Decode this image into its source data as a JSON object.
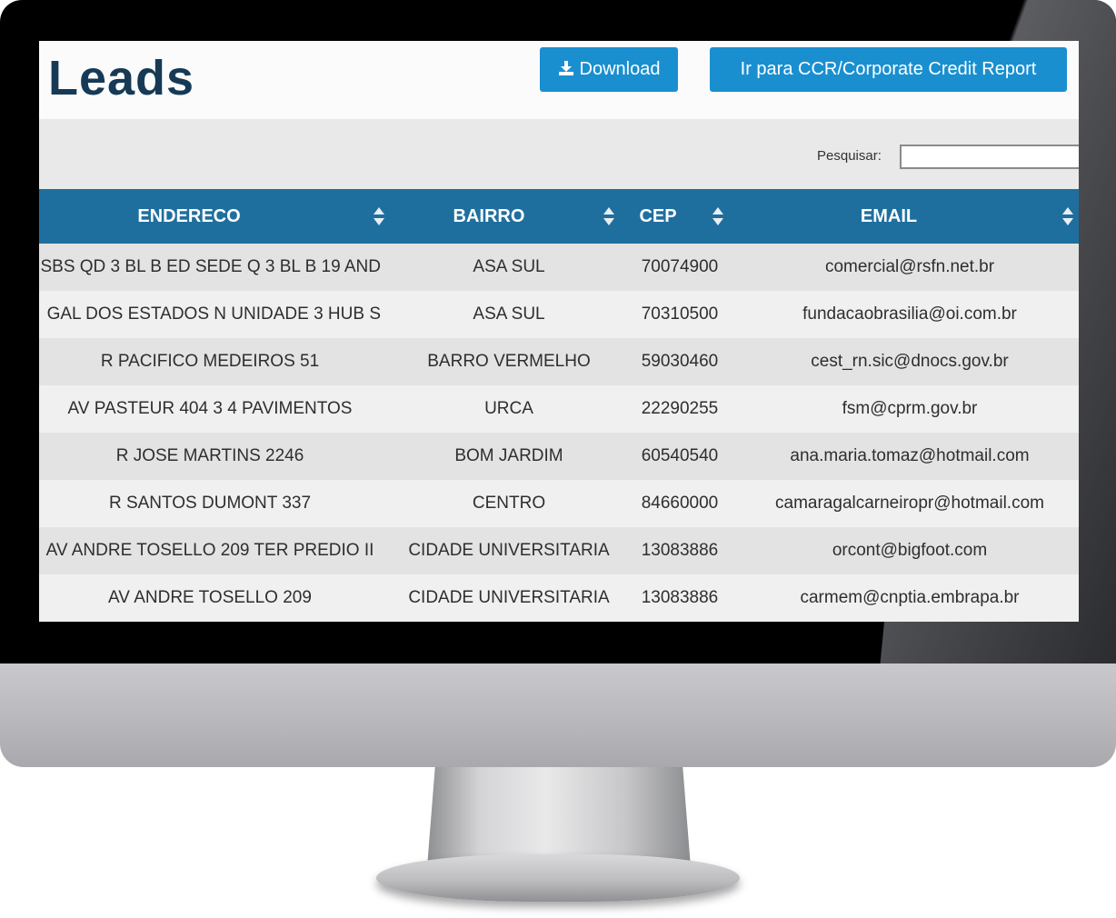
{
  "page": {
    "title": "Leads",
    "download_label": "Download",
    "ccr_label": "Ir para CCR/Corporate Credit Report"
  },
  "search": {
    "label": "Pesquisar:",
    "value": ""
  },
  "table": {
    "columns": [
      "ENDERECO",
      "BAIRRO",
      "CEP",
      "EMAIL"
    ],
    "rows": [
      {
        "endereco": "SBS QD 3 BL B ED SEDE Q 3 BL B 19 AND",
        "bairro": "ASA SUL",
        "cep": "70074900",
        "email": "comercial@rsfn.net.br"
      },
      {
        "endereco": "GAL DOS ESTADOS N UNIDADE 3 HUB S",
        "bairro": "ASA SUL",
        "cep": "70310500",
        "email": "fundacaobrasilia@oi.com.br"
      },
      {
        "endereco": "R PACIFICO MEDEIROS 51",
        "bairro": "BARRO VERMELHO",
        "cep": "59030460",
        "email": "cest_rn.sic@dnocs.gov.br"
      },
      {
        "endereco": "AV PASTEUR 404 3 4 PAVIMENTOS",
        "bairro": "URCA",
        "cep": "22290255",
        "email": "fsm@cprm.gov.br"
      },
      {
        "endereco": "R JOSE MARTINS 2246",
        "bairro": "BOM JARDIM",
        "cep": "60540540",
        "email": "ana.maria.tomaz@hotmail.com"
      },
      {
        "endereco": "R SANTOS DUMONT 337",
        "bairro": "CENTRO",
        "cep": "84660000",
        "email": "camaragalcarneiropr@hotmail.com"
      },
      {
        "endereco": "AV ANDRE TOSELLO 209 TER PREDIO II",
        "bairro": "CIDADE UNIVERSITARIA",
        "cep": "13083886",
        "email": "orcont@bigfoot.com"
      },
      {
        "endereco": "AV ANDRE TOSELLO 209",
        "bairro": "CIDADE UNIVERSITARIA",
        "cep": "13083886",
        "email": "carmem@cnptia.embrapa.br"
      }
    ]
  },
  "colors": {
    "header_blue": "#1f6f9e",
    "button_blue": "#1a8fd0",
    "title_navy": "#163a56"
  },
  "icons": [
    "download-icon",
    "sort-icon"
  ]
}
